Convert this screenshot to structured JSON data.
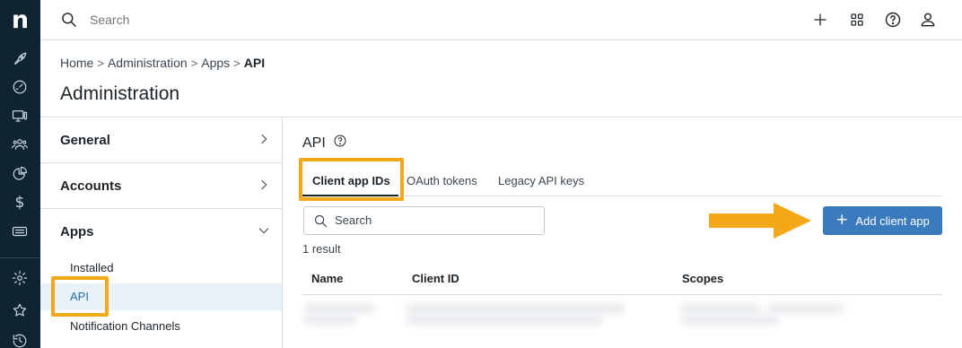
{
  "app": {
    "logo_letter": "n"
  },
  "topbar": {
    "search_placeholder": "Search"
  },
  "breadcrumb": {
    "items": [
      "Home",
      "Administration",
      "Apps"
    ],
    "current": "API",
    "separator": ">"
  },
  "page": {
    "title": "Administration"
  },
  "leftnav": {
    "sections": [
      {
        "label": "General",
        "state": "collapsed"
      },
      {
        "label": "Accounts",
        "state": "collapsed"
      },
      {
        "label": "Apps",
        "state": "expanded"
      }
    ],
    "apps_items": [
      {
        "label": "Installed"
      },
      {
        "label": "API",
        "active": true
      },
      {
        "label": "Notification Channels"
      }
    ]
  },
  "main": {
    "title": "API",
    "tabs": [
      {
        "label": "Client app IDs",
        "active": true
      },
      {
        "label": "OAuth tokens"
      },
      {
        "label": "Legacy API keys"
      }
    ],
    "search_placeholder": "Search",
    "add_button_label": "Add client app",
    "result_count": "1 result",
    "table": {
      "columns": [
        "Name",
        "Client ID",
        "Scopes"
      ]
    }
  },
  "colors": {
    "rail": "#0e2433",
    "accent": "#3b7bbd",
    "highlight": "#f2a818",
    "active_bg": "#e9f1f9"
  }
}
